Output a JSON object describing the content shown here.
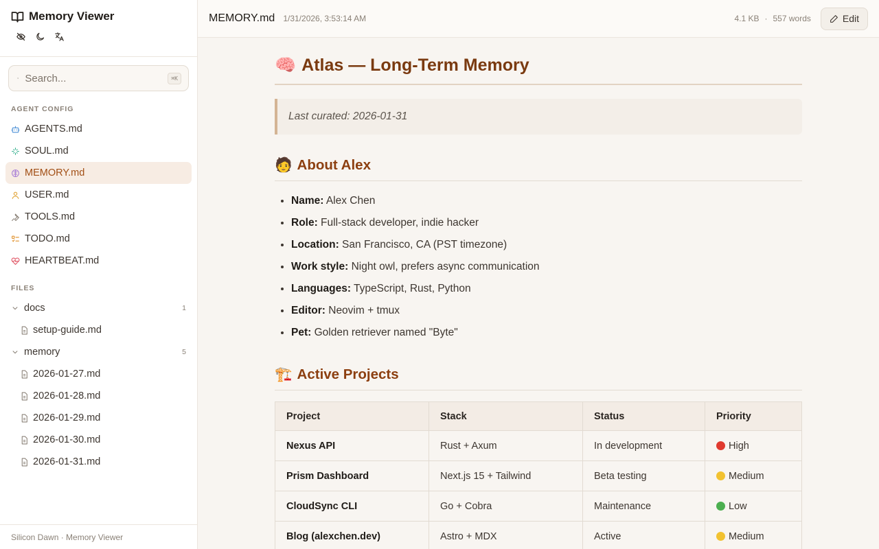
{
  "app": {
    "title": "Memory Viewer",
    "footer": "Silicon Dawn · Memory Viewer"
  },
  "search": {
    "placeholder": "Search...",
    "shortcut": "⌘K"
  },
  "sidebar": {
    "agent_config_label": "AGENT CONFIG",
    "items": [
      {
        "label": "AGENTS.md",
        "icon": "robot-icon",
        "color": "#4a8fd6"
      },
      {
        "label": "SOUL.md",
        "icon": "sparkle-icon",
        "color": "#2fae8a"
      },
      {
        "label": "MEMORY.md",
        "icon": "brain-icon",
        "color": "#a57ad6",
        "active": true
      },
      {
        "label": "USER.md",
        "icon": "user-icon",
        "color": "#e0a030"
      },
      {
        "label": "TOOLS.md",
        "icon": "wrench-icon",
        "color": "#8a8177"
      },
      {
        "label": "TODO.md",
        "icon": "checklist-icon",
        "color": "#e0902a"
      },
      {
        "label": "HEARTBEAT.md",
        "icon": "heart-pulse-icon",
        "color": "#e05565"
      }
    ],
    "files_label": "FILES",
    "folders": [
      {
        "name": "docs",
        "count": "1",
        "files": [
          "setup-guide.md"
        ]
      },
      {
        "name": "memory",
        "count": "5",
        "files": [
          "2026-01-27.md",
          "2026-01-28.md",
          "2026-01-29.md",
          "2026-01-30.md",
          "2026-01-31.md"
        ]
      }
    ]
  },
  "topbar": {
    "filename": "MEMORY.md",
    "date": "1/31/2026, 3:53:14 AM",
    "size": "4.1 KB",
    "separator": "·",
    "words": "557 words",
    "edit_label": "Edit"
  },
  "doc": {
    "title_emoji": "🧠",
    "title": "Atlas — Long-Term Memory",
    "quote": "Last curated: 2026-01-31",
    "about_emoji": "🧑",
    "about_heading": "About Alex",
    "about_items": [
      {
        "key": "Name:",
        "value": " Alex Chen"
      },
      {
        "key": "Role:",
        "value": " Full-stack developer, indie hacker"
      },
      {
        "key": "Location:",
        "value": " San Francisco, CA (PST timezone)"
      },
      {
        "key": "Work style:",
        "value": " Night owl, prefers async communication"
      },
      {
        "key": "Languages:",
        "value": " TypeScript, Rust, Python"
      },
      {
        "key": "Editor:",
        "value": " Neovim + tmux"
      },
      {
        "key": "Pet:",
        "value": " Golden retriever named \"Byte\""
      }
    ],
    "projects_emoji": "🏗️",
    "projects_heading": "Active Projects",
    "table": {
      "headers": [
        "Project",
        "Stack",
        "Status",
        "Priority"
      ],
      "rows": [
        {
          "project": "Nexus API",
          "stack": "Rust + Axum",
          "status": "In development",
          "priority": "High",
          "priority_color": "#e03a2f"
        },
        {
          "project": "Prism Dashboard",
          "stack": "Next.js 15 + Tailwind",
          "status": "Beta testing",
          "priority": "Medium",
          "priority_color": "#f2c230"
        },
        {
          "project": "CloudSync CLI",
          "stack": "Go + Cobra",
          "status": "Maintenance",
          "priority": "Low",
          "priority_color": "#4caf50"
        },
        {
          "project": "Blog (alexchen.dev)",
          "stack": "Astro + MDX",
          "status": "Active",
          "priority": "Medium",
          "priority_color": "#f2c230"
        }
      ]
    }
  }
}
